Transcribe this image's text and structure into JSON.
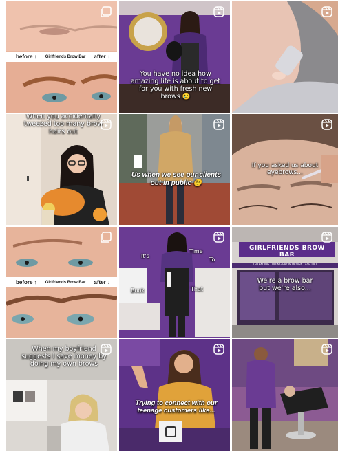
{
  "grid": {
    "tiles": [
      {
        "id": "t1",
        "type": "carousel",
        "strip": {
          "before": "before ↑",
          "brand": "Girlfriends Brow Bar",
          "after": "after ↓"
        }
      },
      {
        "id": "t2",
        "type": "reel",
        "caption": "You have no idea how amazing life is about to get for you with fresh new brows 🥲"
      },
      {
        "id": "t3",
        "type": "reel"
      },
      {
        "id": "t4",
        "type": "reel",
        "caption": "When you accidentally tweezed too many brow hairs out"
      },
      {
        "id": "t5",
        "type": "reel",
        "caption": "Us when we see our clients out in public 😉"
      },
      {
        "id": "t6",
        "type": "reel",
        "caption": "If you asked us about eyebrows..."
      },
      {
        "id": "t7",
        "type": "carousel",
        "strip": {
          "before": "before ↑",
          "brand": "Girlfriends Brow Bar",
          "after": "after ↓"
        }
      },
      {
        "id": "t8",
        "type": "reel",
        "words": [
          "It's",
          "Time",
          "To",
          "Book",
          "That"
        ]
      },
      {
        "id": "t9",
        "type": "reel",
        "sign": "GIRLFRIENDS BROW BAR",
        "services": "THREADING  TINTING  BROW DESIGN  LASH LIFT",
        "caption": "We're a brow bar but we're also..."
      },
      {
        "id": "t10",
        "type": "reel",
        "caption": "When my boyfriend suggests I save money by doing my own brows"
      },
      {
        "id": "t11",
        "type": "reel",
        "caption": "Trying to connect with our teenage customers like..."
      },
      {
        "id": "t12",
        "type": "reel"
      }
    ]
  },
  "colors": {
    "purple": "#5b2d8a",
    "skin": "#e8b59c",
    "floor": "#8a4a32",
    "white": "#ffffff"
  }
}
